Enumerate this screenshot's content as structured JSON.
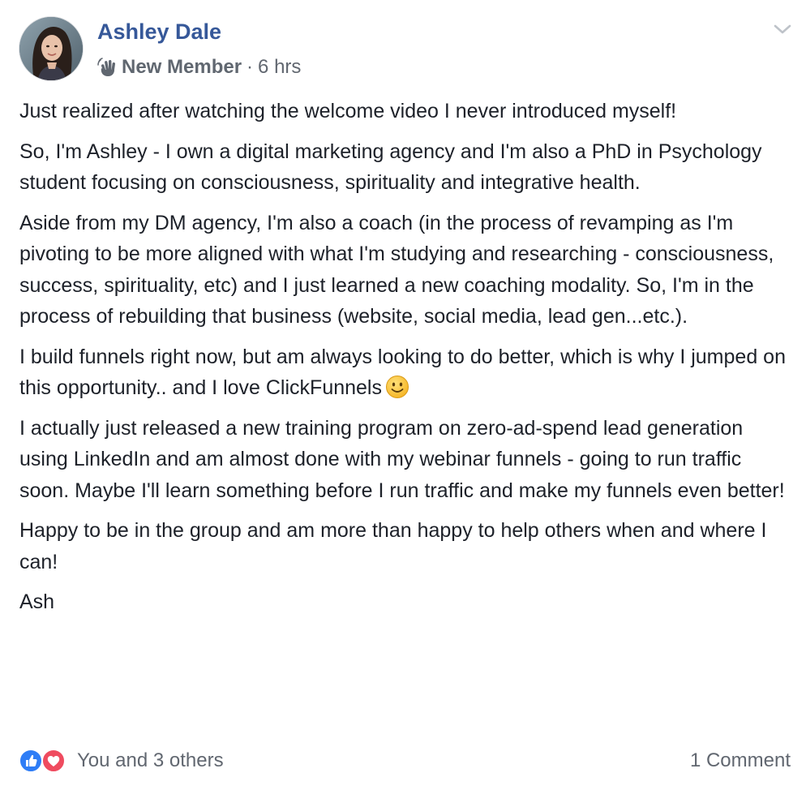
{
  "author": {
    "name": "Ashley Dale",
    "badge": "New Member",
    "separator": "·",
    "time": "6 hrs"
  },
  "post": {
    "paragraphs": [
      "Just realized after watching the welcome video I never introduced myself!",
      "So, I'm Ashley - I own a digital marketing agency and I'm also a PhD in Psychology student focusing on consciousness, spirituality and integrative health.",
      "Aside from my DM agency, I'm also a coach (in the process of revamping as I'm pivoting to be more aligned with what I'm studying and researching - consciousness, success, spirituality, etc) and I just learned a new coaching modality. So, I'm in the process of rebuilding that business (website, social media, lead gen...etc.).",
      "I build funnels right now, but am always looking to do better, which is why I jumped on this opportunity.. and I love ClickFunnels",
      "I actually just released a new training program on zero-ad-spend lead generation using LinkedIn and am almost done with my webinar funnels - going to run traffic soon. Maybe I'll learn something before I run traffic and make my funnels even better!",
      "Happy to be in the group and am more than happy to help others when and where I can!",
      "Ash"
    ]
  },
  "footer": {
    "reactions_text": "You and 3 others",
    "comments_text": "1 Comment"
  },
  "icons": {
    "badge_icon": "wave-hand-icon",
    "menu_icon": "chevron-down-icon",
    "emoji": "smiley-icon",
    "reaction_like": "like-reaction-icon",
    "reaction_love": "love-reaction-icon"
  },
  "colors": {
    "author_link": "#365899",
    "secondary_text": "#616770",
    "body_text": "#1d2129",
    "like_blue": "#2e7df6",
    "love_red": "#ef4b5f"
  }
}
